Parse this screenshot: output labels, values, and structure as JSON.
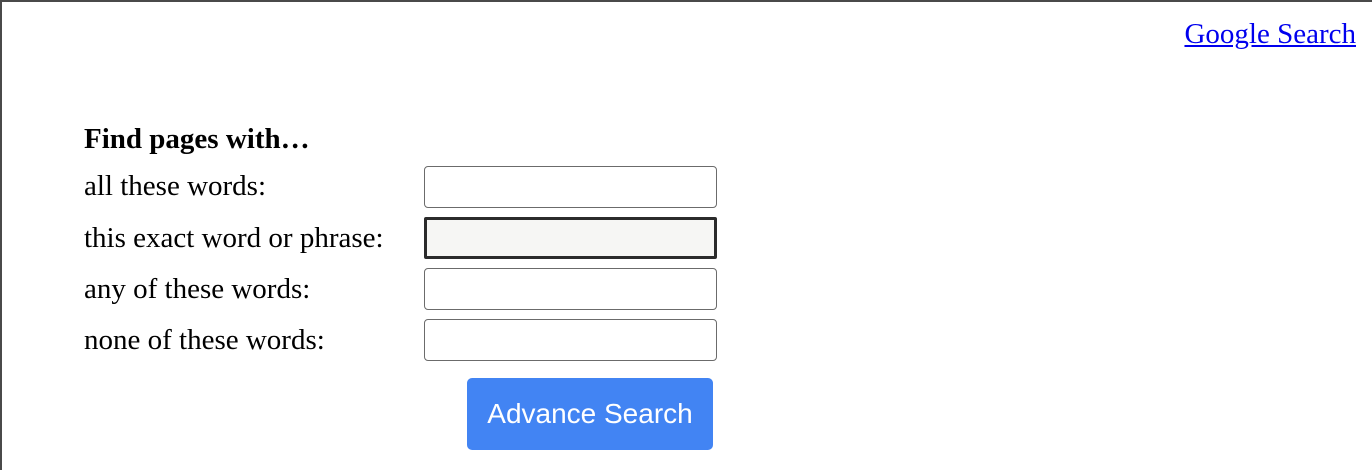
{
  "header": {
    "link_label": "Google Search"
  },
  "form": {
    "heading": "Find pages with…",
    "rows": [
      {
        "label": "all these words:",
        "value": ""
      },
      {
        "label": "this exact word or phrase:",
        "value": ""
      },
      {
        "label": "any of these words:",
        "value": ""
      },
      {
        "label": "none of these words:",
        "value": ""
      }
    ],
    "submit_label": "Advance Search"
  },
  "colors": {
    "link": "#0000ee",
    "button": "#4284f3",
    "focused_field_bg": "#f6f6f4"
  }
}
